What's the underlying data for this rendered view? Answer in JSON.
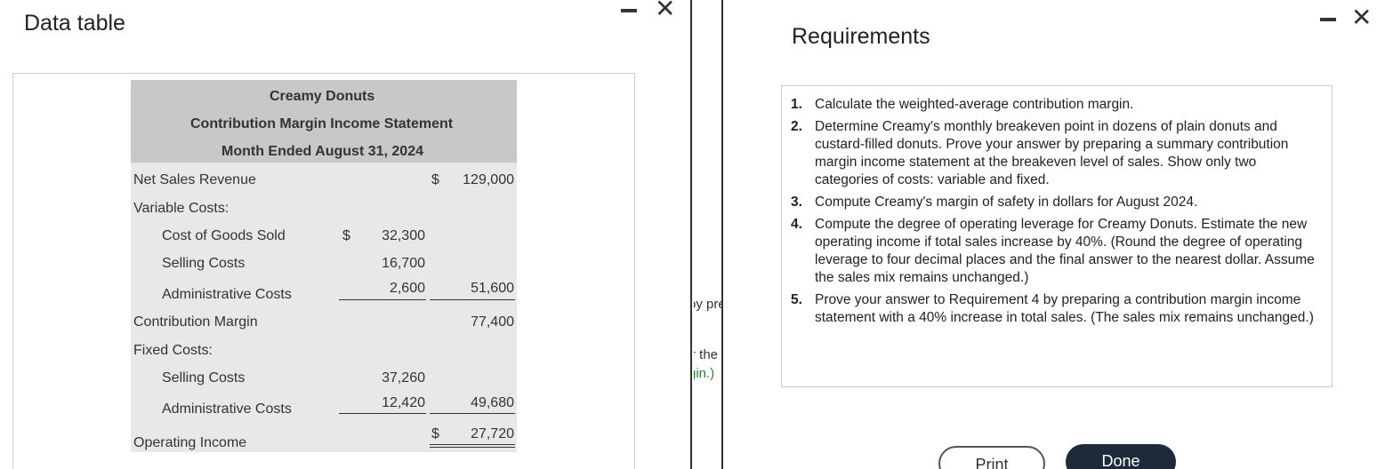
{
  "left_dialog": {
    "title": "Data table",
    "statement": {
      "company": "Creamy Donuts",
      "name": "Contribution Margin Income Statement",
      "period": "Month Ended August 31, 2024",
      "net_sales_label": "Net Sales Revenue",
      "net_sales_dollar": "$",
      "net_sales_value": "129,000",
      "variable_costs_label": "Variable Costs:",
      "cogs_label": "Cost of Goods Sold",
      "cogs_dollar": "$",
      "cogs_value": "32,300",
      "var_selling_label": "Selling Costs",
      "var_selling_value": "16,700",
      "var_admin_label": "Administrative Costs",
      "var_admin_value": "2,600",
      "var_total_value": "51,600",
      "cm_label": "Contribution Margin",
      "cm_value": "77,400",
      "fixed_costs_label": "Fixed Costs:",
      "fix_selling_label": "Selling Costs",
      "fix_selling_value": "37,260",
      "fix_admin_label": "Administrative Costs",
      "fix_admin_value": "12,420",
      "fix_total_value": "49,680",
      "oi_label": "Operating Income",
      "oi_dollar": "$",
      "oi_value": "27,720"
    }
  },
  "background_dialog": {
    "fragment_1": "by pre",
    "fragment_2": "r the",
    "fragment_3": "gin.)"
  },
  "right_dialog": {
    "title": "Requirements",
    "requirements": [
      {
        "n": "1.",
        "text": "Calculate the weighted-average contribution margin."
      },
      {
        "n": "2.",
        "text": "Determine Creamy's monthly breakeven point in dozens of plain donuts and custard-filled donuts. Prove your answer by preparing a summary contribution margin income statement at the breakeven level of sales. Show only two categories of costs: variable and fixed."
      },
      {
        "n": "3.",
        "text": "Compute Creamy's margin of safety in dollars for August 2024."
      },
      {
        "n": "4.",
        "text": "Compute the degree of operating leverage for Creamy Donuts. Estimate the new operating income if total sales increase by 40%. (Round the degree of operating leverage to four decimal places and the final answer to the nearest dollar. Assume the sales mix remains unchanged.)"
      },
      {
        "n": "5.",
        "text": "Prove your answer to Requirement 4 by preparing a contribution margin income statement with a 40% increase in total sales. (The sales mix remains unchanged.)"
      }
    ],
    "print_label": "Print",
    "done_label": "Done"
  },
  "colors": {
    "header_bg": "#c8c8c8",
    "table_bg": "#e8e8e8",
    "done_button": "#1e2a3a",
    "green_text": "#2e7d32"
  }
}
